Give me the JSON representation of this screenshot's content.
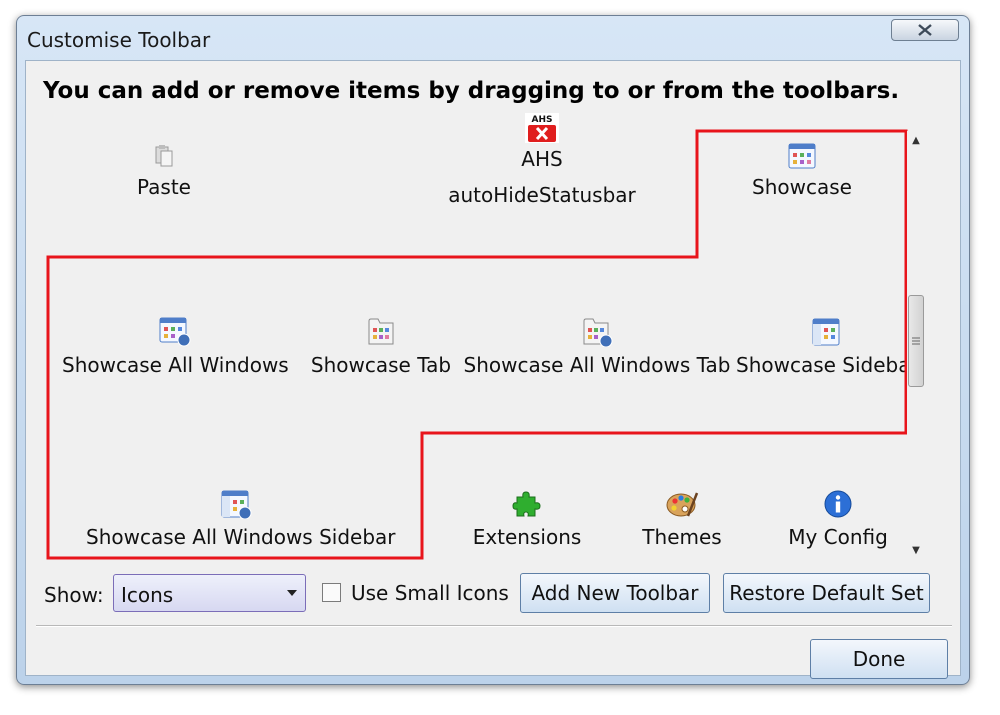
{
  "window": {
    "title": "Customise Toolbar"
  },
  "instructions": "You can add or remove items by dragging to or from the toolbars.",
  "items": [
    {
      "label": "Paste",
      "icon": "paste-icon"
    },
    {
      "label": "AHS",
      "sublabel": "autoHideStatusbar",
      "icon_text": "AHS",
      "icon": "ahs-icon"
    },
    {
      "label": "Showcase",
      "icon": "showcase-icon"
    },
    {
      "label": "Showcase All Windows",
      "icon": "showcase-all-windows-icon"
    },
    {
      "label": "Showcase Tab",
      "icon": "showcase-tab-icon"
    },
    {
      "label": "Showcase All Windows Tab",
      "icon": "showcase-all-windows-tab-icon"
    },
    {
      "label": "Showcase Sidebar",
      "icon": "showcase-sidebar-icon"
    },
    {
      "label": "Showcase All Windows Sidebar",
      "icon": "showcase-all-windows-sidebar-icon"
    },
    {
      "label": "Extensions",
      "icon": "puzzle-icon"
    },
    {
      "label": "Themes",
      "icon": "palette-icon"
    },
    {
      "label": "My Config",
      "icon": "info-icon"
    }
  ],
  "controls": {
    "show_label": "Show:",
    "show_value": "Icons",
    "small_icons_label": "Use Small Icons",
    "small_icons_checked": false,
    "add_toolbar_label": "Add New Toolbar",
    "restore_label": "Restore Default Set",
    "done_label": "Done"
  },
  "colors": {
    "highlight": "#e8141b",
    "accent": "#5e7fa6"
  }
}
